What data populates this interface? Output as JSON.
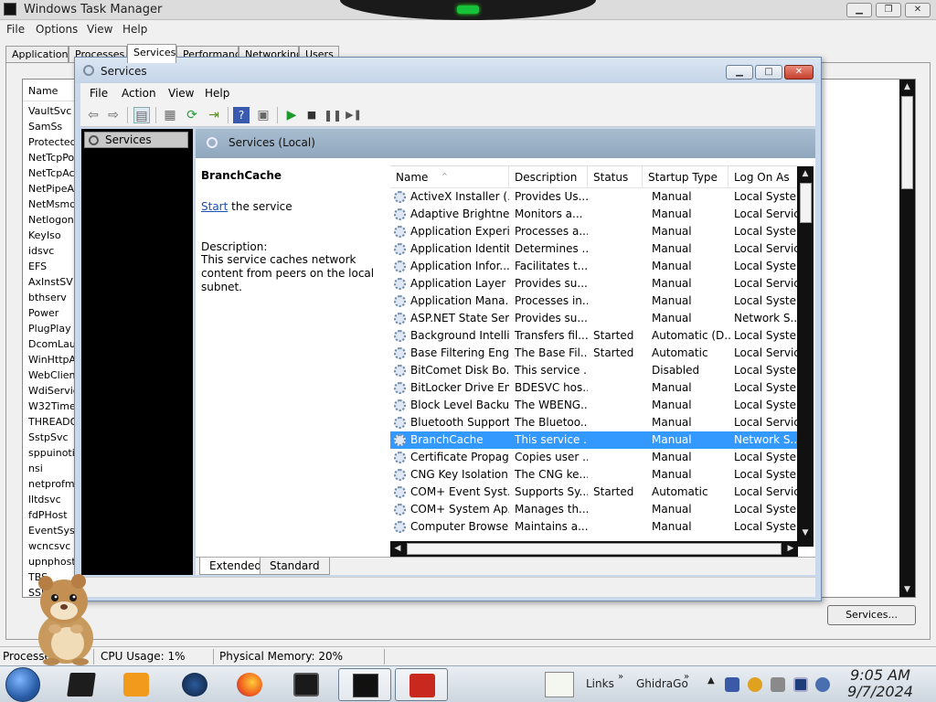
{
  "taskmgr": {
    "title": "Windows Task Manager",
    "menu": [
      "File",
      "Options",
      "View",
      "Help"
    ],
    "tabs": [
      "Applications",
      "Processes",
      "Services",
      "Performance",
      "Networking",
      "Users"
    ],
    "list_header": "Name",
    "list_rows": [
      "VaultSvc",
      "SamSs",
      "ProtectedS",
      "NetTcpPor",
      "NetTcpAct",
      "NetPipeAc",
      "NetMsmqA",
      "Netlogon",
      "KeyIso",
      "idsvc",
      "EFS",
      "AxInstSV",
      "bthserv",
      "Power",
      "PlugPlay",
      "DcomLaun",
      "WinHttpAu",
      "WebClient",
      "WdiService",
      "W32Time",
      "THREADO",
      "SstpSvc",
      "sppuinotif",
      "nsi",
      "netprofm",
      "lltdsvc",
      "fdPHost",
      "EventSyst",
      "wcncsvc",
      "upnphost",
      "TBS",
      "SSD"
    ],
    "services_button": "Services...",
    "status": {
      "processes": "Processes:",
      "cpu": "CPU Usage: 1%",
      "memory": "Physical Memory: 20%"
    }
  },
  "services": {
    "title": "Services",
    "menu": [
      "File",
      "Action",
      "View",
      "Help"
    ],
    "tree_item": "Services (Local)",
    "content_header": "Services (Local)",
    "selected_name": "BranchCache",
    "start_link": "Start",
    "start_rest": " the service",
    "description_label": "Description:",
    "description_text": "This service caches network content from peers on the local subnet.",
    "columns": [
      "Name",
      "Description",
      "Status",
      "Startup Type",
      "Log On As"
    ],
    "rows": [
      [
        "ActiveX Installer (...",
        "Provides Us...",
        "",
        "Manual",
        "Local Syste..."
      ],
      [
        "Adaptive Brightness",
        "Monitors a...",
        "",
        "Manual",
        "Local Service"
      ],
      [
        "Application Experi...",
        "Processes a...",
        "",
        "Manual",
        "Local Syste..."
      ],
      [
        "Application Identity",
        "Determines ...",
        "",
        "Manual",
        "Local Service"
      ],
      [
        "Application Infor...",
        "Facilitates t...",
        "",
        "Manual",
        "Local Syste..."
      ],
      [
        "Application Layer ...",
        "Provides su...",
        "",
        "Manual",
        "Local Service"
      ],
      [
        "Application Mana...",
        "Processes in...",
        "",
        "Manual",
        "Local Syste..."
      ],
      [
        "ASP.NET State Ser...",
        "Provides su...",
        "",
        "Manual",
        "Network S..."
      ],
      [
        "Background Intelli...",
        "Transfers fil...",
        "Started",
        "Automatic (D...",
        "Local Syste..."
      ],
      [
        "Base Filtering Engi...",
        "The Base Fil...",
        "Started",
        "Automatic",
        "Local Service"
      ],
      [
        "BitComet Disk Bo...",
        "This service ...",
        "",
        "Disabled",
        "Local Syste..."
      ],
      [
        "BitLocker Drive En...",
        "BDESVC hos...",
        "",
        "Manual",
        "Local Syste..."
      ],
      [
        "Block Level Backu...",
        "The WBENG...",
        "",
        "Manual",
        "Local Syste..."
      ],
      [
        "Bluetooth Support...",
        "The Bluetoo...",
        "",
        "Manual",
        "Local Service"
      ],
      [
        "BranchCache",
        "This service ...",
        "",
        "Manual",
        "Network S..."
      ],
      [
        "Certificate Propag...",
        "Copies user ...",
        "",
        "Manual",
        "Local Syste..."
      ],
      [
        "CNG Key Isolation",
        "The CNG ke...",
        "",
        "Manual",
        "Local Syste..."
      ],
      [
        "COM+ Event Syst...",
        "Supports Sy...",
        "Started",
        "Automatic",
        "Local Service"
      ],
      [
        "COM+ System Ap...",
        "Manages th...",
        "",
        "Manual",
        "Local Syste..."
      ],
      [
        "Computer Browser",
        "Maintains a...",
        "",
        "Manual",
        "Local Syste..."
      ]
    ],
    "selected_row_index": 14,
    "view_tabs": [
      "Extended",
      "Standard"
    ]
  },
  "taskbar": {
    "links_label": "Links",
    "ghidra_label": "GhidraGo",
    "time": "9:05 AM",
    "date": "9/7/2024"
  }
}
